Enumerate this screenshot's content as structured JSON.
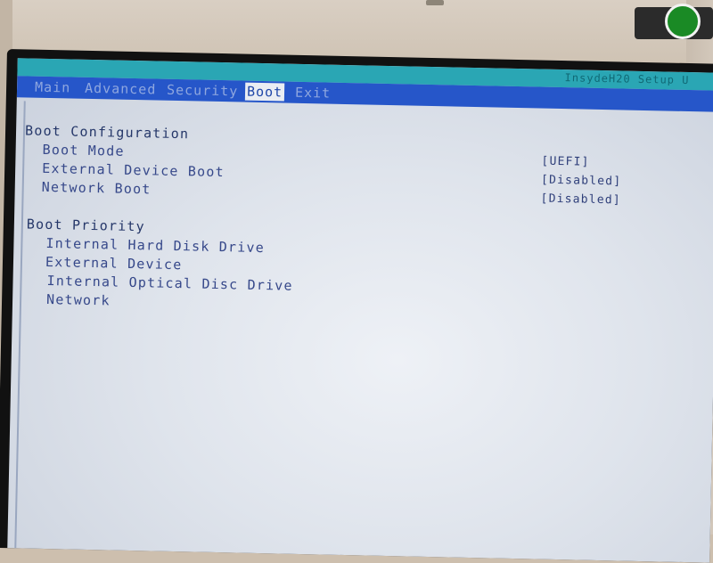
{
  "bios": {
    "brand": "InsydeH20 Setup U",
    "menu": [
      {
        "label": "Main",
        "active": false
      },
      {
        "label": "Advanced",
        "active": false
      },
      {
        "label": "Security",
        "active": false
      },
      {
        "label": "Boot",
        "active": true
      },
      {
        "label": "Exit",
        "active": false
      }
    ]
  },
  "boot_config": {
    "heading": "Boot Configuration",
    "items": [
      {
        "label": "Boot Mode",
        "value": "[UEFI]"
      },
      {
        "label": "External Device Boot",
        "value": "[Disabled]"
      },
      {
        "label": "Network Boot",
        "value": "[Disabled]"
      }
    ]
  },
  "boot_priority": {
    "heading": "Boot Priority",
    "items": [
      "Internal Hard Disk Drive",
      "External Device",
      "Internal Optical Disc Drive",
      "Network"
    ]
  },
  "colors": {
    "menu_bar": "#2656c9",
    "title_band": "#2aa6b4",
    "text": "#2b3a73",
    "power_led": "#1a8a25"
  }
}
